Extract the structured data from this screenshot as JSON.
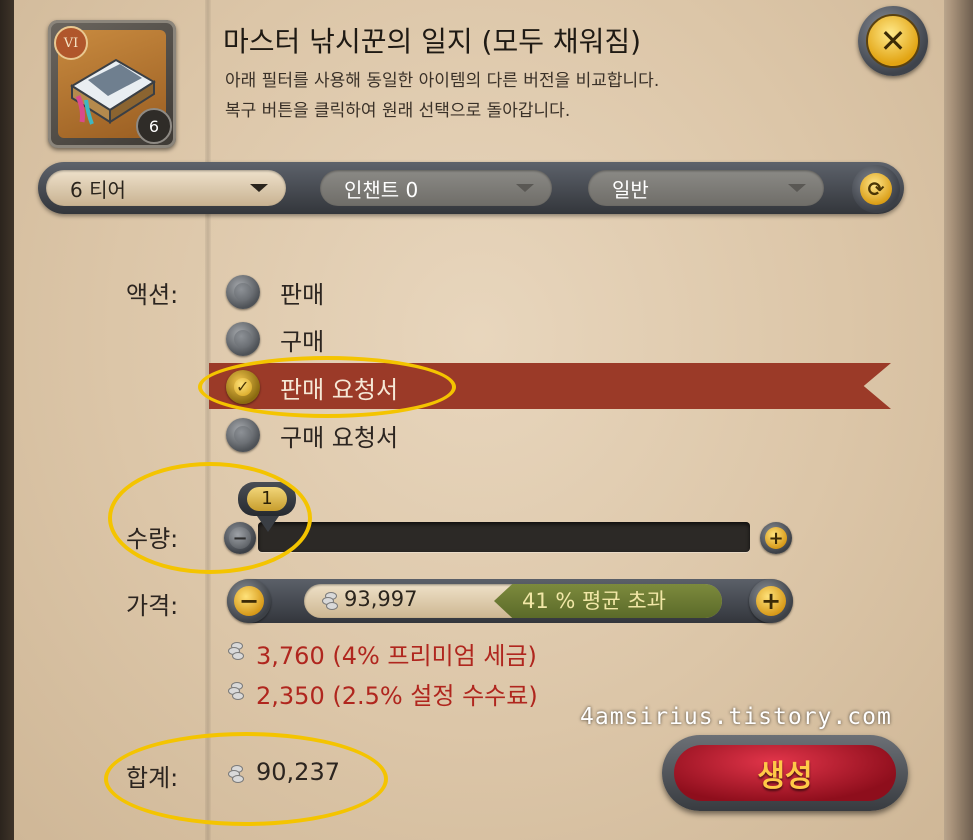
{
  "header": {
    "title": "마스터 낚시꾼의 일지 (모두 채워짐)",
    "desc_line1": "아래 필터를 사용해 동일한 아이템의 다른 버전을 비교합니다.",
    "desc_line2": "복구 버튼을 클릭하여 원래 선택으로 돌아갑니다.",
    "tier_badge": "VI",
    "item_count": "6"
  },
  "filters": {
    "tier": "6 티어",
    "enchant": "인챈트 0",
    "quality": "일반"
  },
  "action": {
    "label": "액션:",
    "options": [
      "판매",
      "구매",
      "판매 요청서",
      "구매 요청서"
    ],
    "selected": "판매 요청서"
  },
  "quantity": {
    "label": "수량:",
    "value": "1"
  },
  "price": {
    "label": "가격:",
    "value": "93,997",
    "badge": "41 % 평균 초과"
  },
  "fees": {
    "premium_tax": "3,760 (4% 프리미엄 세금)",
    "setup_fee": "2,350 (2.5% 설정 수수료)"
  },
  "total": {
    "label": "합계:",
    "value": "90,237"
  },
  "create_button": "생성",
  "watermark": "4amsirius.tistory.com",
  "colors": {
    "selected_band": "#9b3a28",
    "fee_text": "#b0261e",
    "annotation": "#f4c400",
    "button_gold": "#d59614"
  }
}
